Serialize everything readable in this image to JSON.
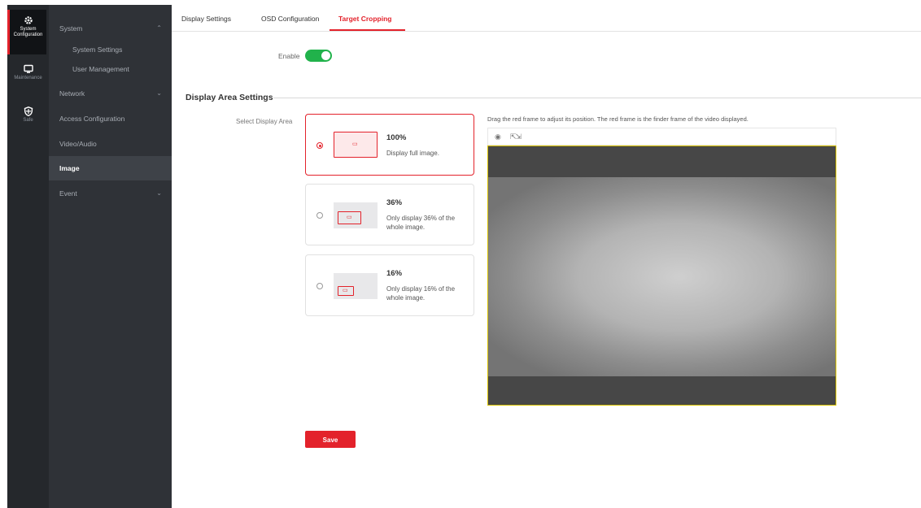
{
  "rail": {
    "items": [
      {
        "label": "System Configuration",
        "icon": "gear-icon",
        "active": true
      },
      {
        "label": "Maintenance",
        "icon": "monitor-icon",
        "active": false
      },
      {
        "label": "Safe",
        "icon": "shield-icon",
        "active": false
      }
    ]
  },
  "menu": {
    "system": "System",
    "system_settings": "System Settings",
    "user_management": "User Management",
    "network": "Network",
    "access_configuration": "Access Configuration",
    "video_audio": "Video/Audio",
    "image": "Image",
    "event": "Event"
  },
  "tabs": [
    "Display Settings",
    "OSD Configuration",
    "Target Cropping"
  ],
  "active_tab": "Target Cropping",
  "enable": {
    "label": "Enable",
    "on": true
  },
  "section_title": "Display Area Settings",
  "select_label": "Select Display Area",
  "options": [
    {
      "title": "100%",
      "desc": "Display full image.",
      "selected": true
    },
    {
      "title": "36%",
      "desc": "Only display 36% of the whole image.",
      "selected": false
    },
    {
      "title": "16%",
      "desc": "Only display 16% of the whole image.",
      "selected": false
    }
  ],
  "hint": "Drag the red frame to adjust its position. The red frame is the finder frame of the video displayed.",
  "save_label": "Save",
  "colors": {
    "accent": "#e3222b",
    "toggle_on": "#21b24b",
    "video_border": "#d9c200",
    "sidebar": "#2f3237"
  }
}
